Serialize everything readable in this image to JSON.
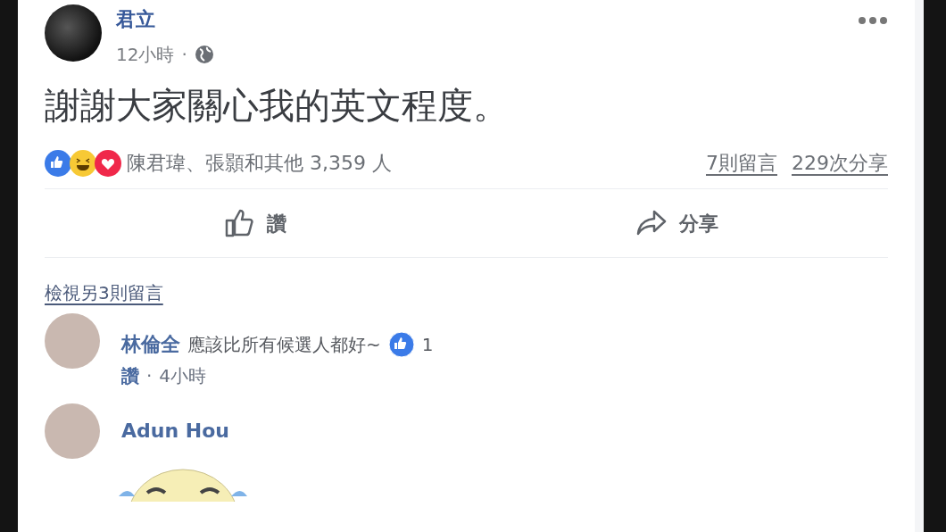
{
  "post": {
    "author": "君立",
    "time": "12小時",
    "separator": "·",
    "public": true,
    "text": "謝謝大家關心我的英文程度。",
    "reactions": {
      "items": [
        {
          "kind": "like"
        },
        {
          "kind": "haha"
        },
        {
          "kind": "love"
        }
      ],
      "names": "陳君瑋、張顥和其他 3,359 人"
    },
    "comments_count": "7則留言",
    "shares_count": "229次分享",
    "actions": [
      {
        "kind": "like",
        "label": "讚"
      },
      {
        "kind": "share",
        "label": "分享"
      }
    ]
  },
  "comments": {
    "more": "檢視另3則留言",
    "items": [
      {
        "kind": "text",
        "author": "林倫全",
        "text": "應該比所有候選人都好~",
        "like_count": "1",
        "action": "讚",
        "separator": "·",
        "time": "4小時"
      },
      {
        "kind": "sticker",
        "author": "Adun Hou"
      }
    ]
  }
}
